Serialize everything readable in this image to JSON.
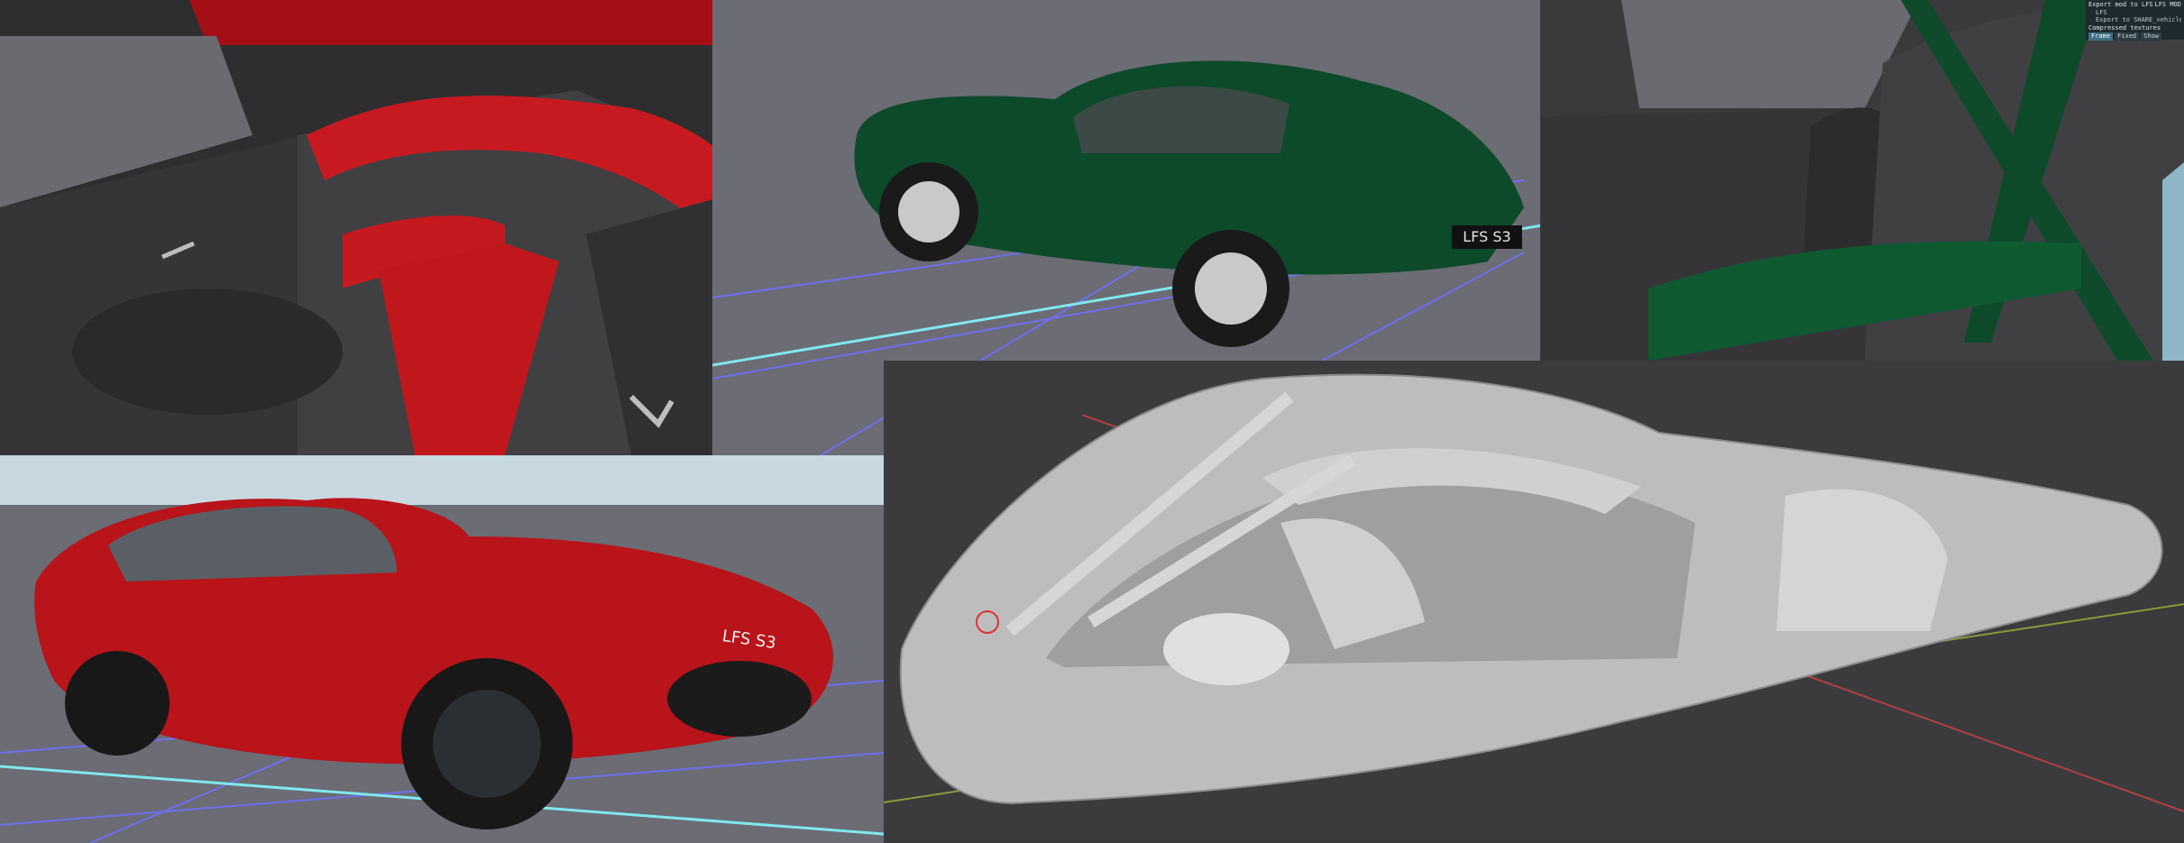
{
  "panels": [
    {
      "id": "red-interior",
      "view": "Red car interior render"
    },
    {
      "id": "green-exterior",
      "view": "Green coupe exterior render",
      "plate": "LFS S3"
    },
    {
      "id": "green-interior",
      "view": "Green car interior render with roll cage"
    },
    {
      "id": "red-exterior",
      "view": "Red coupe exterior render",
      "plate": "LFS S3"
    },
    {
      "id": "mesh-editor",
      "view": "Grey mesh cutaway view in 3D editor"
    }
  ],
  "export_overlay": {
    "line1": "Export mod to LFS",
    "line1_right": "LFS MOD",
    "line2": "LFS",
    "line3": "Export to SHARE_vehicle",
    "line4": "Compressed textures",
    "tabs": [
      "Frame",
      "Fixed",
      "Show"
    ],
    "active_tab": "Frame"
  },
  "colors": {
    "red_paint": "#b8141a",
    "green_paint": "#0d4a2a",
    "studio_ground": "#6b6c74",
    "grid_blue": "#6f6ff0",
    "grid_cyan": "#7fe8ee",
    "mesh_grey": "#bdbdbd",
    "editor_bg": "#3b3b3d"
  }
}
